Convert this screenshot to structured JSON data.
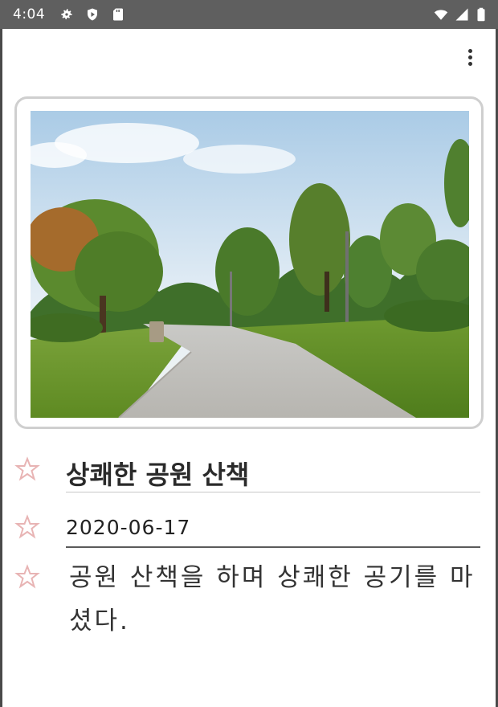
{
  "status_bar": {
    "time": "4:04",
    "icons": [
      "gear-icon",
      "play-shield-icon",
      "sd-card-icon",
      "wifi-icon",
      "signal-icon",
      "battery-icon"
    ]
  },
  "app_bar": {
    "menu_icon": "more-vert-icon"
  },
  "entry": {
    "photo_description_icon": "park-photo",
    "title": "상쾌한 공원 산책",
    "date": "2020-06-17",
    "content": "공원 산책을 하며 상쾌한 공기를 마셨다.",
    "field_icon": "star-outline-icon"
  },
  "colors": {
    "status_bar": "#5f5f5f",
    "star_icon": "#e8b4b4",
    "card_border": "#cfcfcf"
  }
}
